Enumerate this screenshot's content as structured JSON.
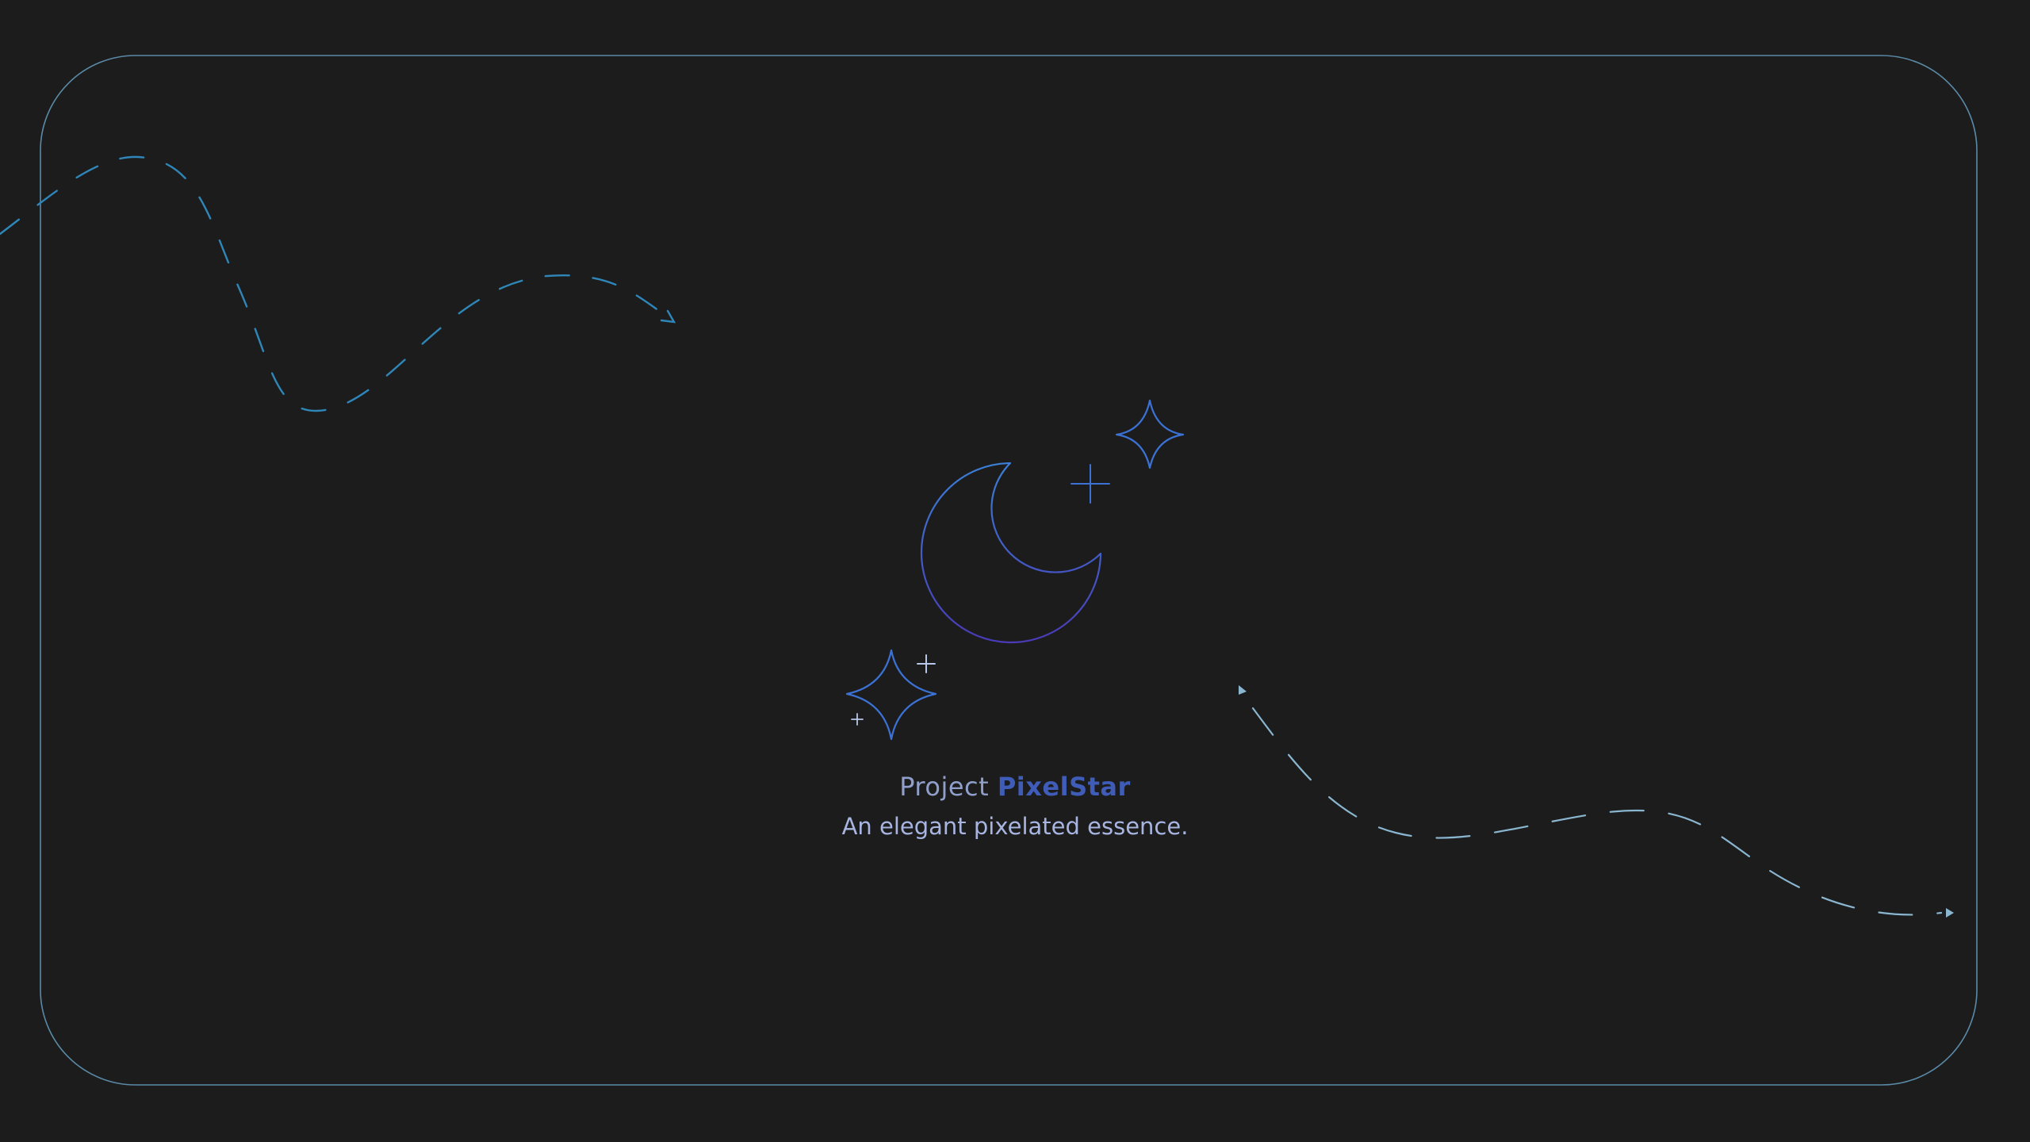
{
  "title": {
    "prefix": "Project",
    "brand": "PixelStar"
  },
  "tagline": "An elegant pixelated essence.",
  "colors": {
    "background": "#1c1c1d",
    "frame": "#5a8aa6",
    "wave_top": "#2f86b8",
    "wave_bottom": "#8ab6cf",
    "moon_top": "#3b7fd6",
    "moon_bottom": "#4a3bb8",
    "sparkle": "#3b72d4",
    "brand": "#3f5db8",
    "text": "#8f9fc9"
  },
  "icons": {
    "moon": "crescent-moon-icon",
    "sparkles": "four-point-star-icon",
    "plus": "plus-sparkle-icon"
  }
}
